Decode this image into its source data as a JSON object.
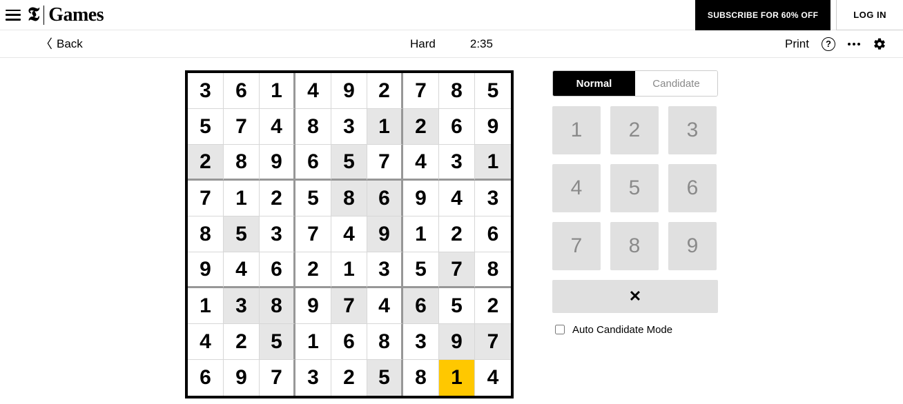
{
  "header": {
    "brand_letter": "𝕿",
    "brand_name": "Games",
    "subscribe": "SUBSCRIBE FOR 60% OFF",
    "login": "LOG IN"
  },
  "toolbar": {
    "back": "Back",
    "difficulty": "Hard",
    "time": "2:35",
    "print": "Print"
  },
  "board": {
    "grid": [
      [
        {
          "v": "3",
          "p": false
        },
        {
          "v": "6",
          "p": false
        },
        {
          "v": "1",
          "p": false
        },
        {
          "v": "4",
          "p": false
        },
        {
          "v": "9",
          "p": false
        },
        {
          "v": "2",
          "p": false
        },
        {
          "v": "7",
          "p": false
        },
        {
          "v": "8",
          "p": false
        },
        {
          "v": "5",
          "p": false
        }
      ],
      [
        {
          "v": "5",
          "p": false
        },
        {
          "v": "7",
          "p": false
        },
        {
          "v": "4",
          "p": false
        },
        {
          "v": "8",
          "p": false
        },
        {
          "v": "3",
          "p": false
        },
        {
          "v": "1",
          "p": true
        },
        {
          "v": "2",
          "p": true
        },
        {
          "v": "6",
          "p": false
        },
        {
          "v": "9",
          "p": false
        }
      ],
      [
        {
          "v": "2",
          "p": true
        },
        {
          "v": "8",
          "p": false
        },
        {
          "v": "9",
          "p": false
        },
        {
          "v": "6",
          "p": false
        },
        {
          "v": "5",
          "p": true
        },
        {
          "v": "7",
          "p": false
        },
        {
          "v": "4",
          "p": false
        },
        {
          "v": "3",
          "p": false
        },
        {
          "v": "1",
          "p": true
        }
      ],
      [
        {
          "v": "7",
          "p": false
        },
        {
          "v": "1",
          "p": false
        },
        {
          "v": "2",
          "p": false
        },
        {
          "v": "5",
          "p": false
        },
        {
          "v": "8",
          "p": true
        },
        {
          "v": "6",
          "p": true
        },
        {
          "v": "9",
          "p": false
        },
        {
          "v": "4",
          "p": false
        },
        {
          "v": "3",
          "p": false
        }
      ],
      [
        {
          "v": "8",
          "p": false
        },
        {
          "v": "5",
          "p": true
        },
        {
          "v": "3",
          "p": false
        },
        {
          "v": "7",
          "p": false
        },
        {
          "v": "4",
          "p": false
        },
        {
          "v": "9",
          "p": true
        },
        {
          "v": "1",
          "p": false
        },
        {
          "v": "2",
          "p": false
        },
        {
          "v": "6",
          "p": false
        }
      ],
      [
        {
          "v": "9",
          "p": false
        },
        {
          "v": "4",
          "p": false
        },
        {
          "v": "6",
          "p": false
        },
        {
          "v": "2",
          "p": false
        },
        {
          "v": "1",
          "p": false
        },
        {
          "v": "3",
          "p": false
        },
        {
          "v": "5",
          "p": false
        },
        {
          "v": "7",
          "p": true
        },
        {
          "v": "8",
          "p": false
        }
      ],
      [
        {
          "v": "1",
          "p": false
        },
        {
          "v": "3",
          "p": true
        },
        {
          "v": "8",
          "p": true
        },
        {
          "v": "9",
          "p": false
        },
        {
          "v": "7",
          "p": true
        },
        {
          "v": "4",
          "p": false
        },
        {
          "v": "6",
          "p": true
        },
        {
          "v": "5",
          "p": false
        },
        {
          "v": "2",
          "p": false
        }
      ],
      [
        {
          "v": "4",
          "p": false
        },
        {
          "v": "2",
          "p": false
        },
        {
          "v": "5",
          "p": true
        },
        {
          "v": "1",
          "p": false
        },
        {
          "v": "6",
          "p": false
        },
        {
          "v": "8",
          "p": false
        },
        {
          "v": "3",
          "p": false
        },
        {
          "v": "9",
          "p": true
        },
        {
          "v": "7",
          "p": true
        }
      ],
      [
        {
          "v": "6",
          "p": false
        },
        {
          "v": "9",
          "p": false
        },
        {
          "v": "7",
          "p": false
        },
        {
          "v": "3",
          "p": false
        },
        {
          "v": "2",
          "p": false
        },
        {
          "v": "5",
          "p": true
        },
        {
          "v": "8",
          "p": false
        },
        {
          "v": "1",
          "p": false,
          "hl": true
        },
        {
          "v": "4",
          "p": false
        }
      ]
    ]
  },
  "panel": {
    "mode_normal": "Normal",
    "mode_candidate": "Candidate",
    "keys": [
      "1",
      "2",
      "3",
      "4",
      "5",
      "6",
      "7",
      "8",
      "9"
    ],
    "clear_icon": "✕",
    "auto_label": "Auto Candidate Mode"
  }
}
